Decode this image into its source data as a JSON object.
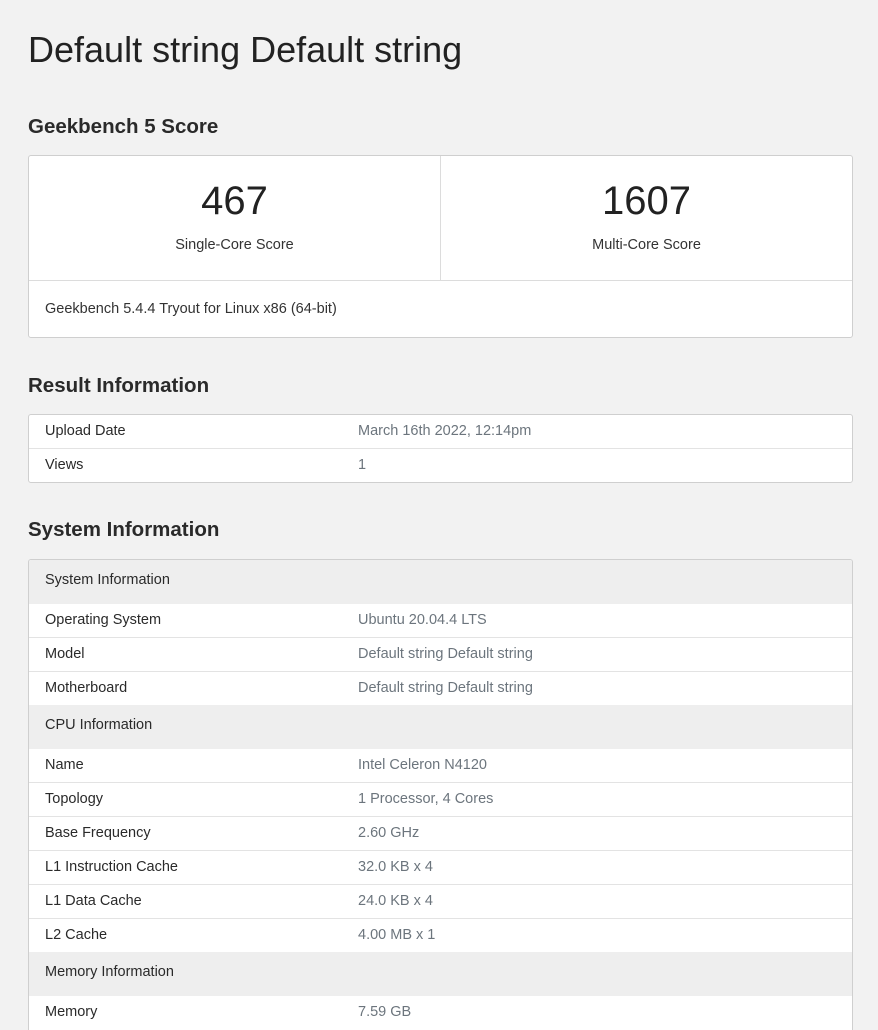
{
  "page": {
    "title": "Default string Default string"
  },
  "score_section": {
    "heading": "Geekbench 5 Score",
    "single_core": {
      "value": "467",
      "label": "Single-Core Score"
    },
    "multi_core": {
      "value": "1607",
      "label": "Multi-Core Score"
    },
    "footer": "Geekbench 5.4.4 Tryout for Linux x86 (64-bit)"
  },
  "result_info": {
    "heading": "Result Information",
    "rows": [
      {
        "key": "Upload Date",
        "value": "March 16th 2022, 12:14pm"
      },
      {
        "key": "Views",
        "value": "1"
      }
    ]
  },
  "system_info": {
    "heading": "System Information",
    "groups": [
      {
        "title": "System Information",
        "rows": [
          {
            "key": "Operating System",
            "value": "Ubuntu 20.04.4 LTS"
          },
          {
            "key": "Model",
            "value": "Default string Default string"
          },
          {
            "key": "Motherboard",
            "value": "Default string Default string"
          }
        ]
      },
      {
        "title": "CPU Information",
        "rows": [
          {
            "key": "Name",
            "value": "Intel Celeron N4120"
          },
          {
            "key": "Topology",
            "value": "1 Processor, 4 Cores"
          },
          {
            "key": "Base Frequency",
            "value": "2.60 GHz"
          },
          {
            "key": "L1 Instruction Cache",
            "value": "32.0 KB x 4"
          },
          {
            "key": "L1 Data Cache",
            "value": "24.0 KB x 4"
          },
          {
            "key": "L2 Cache",
            "value": "4.00 MB x 1"
          }
        ]
      },
      {
        "title": "Memory Information",
        "rows": [
          {
            "key": "Memory",
            "value": "7.59 GB"
          }
        ]
      }
    ]
  }
}
